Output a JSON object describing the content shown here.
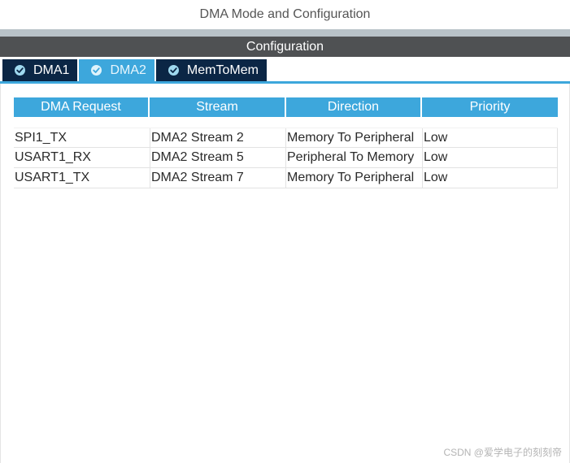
{
  "header": {
    "title": "DMA Mode and Configuration"
  },
  "config_bar": {
    "label": "Configuration"
  },
  "tabs": [
    {
      "label": "DMA1",
      "active": false,
      "icon": "check-circle-icon"
    },
    {
      "label": "DMA2",
      "active": true,
      "icon": "check-circle-icon"
    },
    {
      "label": "MemToMem",
      "active": false,
      "icon": "check-circle-icon"
    }
  ],
  "table": {
    "columns": [
      "DMA Request",
      "Stream",
      "Direction",
      "Priority"
    ],
    "rows": [
      [
        "SPI1_TX",
        "DMA2 Stream 2",
        "Memory To Peripheral",
        "Low"
      ],
      [
        "USART1_RX",
        "DMA2 Stream 5",
        "Peripheral To Memory",
        "Low"
      ],
      [
        "USART1_TX",
        "DMA2 Stream 7",
        "Memory To Peripheral",
        "Low"
      ]
    ]
  },
  "watermark": {
    "text": "CSDN @爱学电子的刻刻帝"
  },
  "colors": {
    "accent": "#3da7dc",
    "tab_dark": "#0b2645",
    "config_bar": "#4f5153"
  }
}
